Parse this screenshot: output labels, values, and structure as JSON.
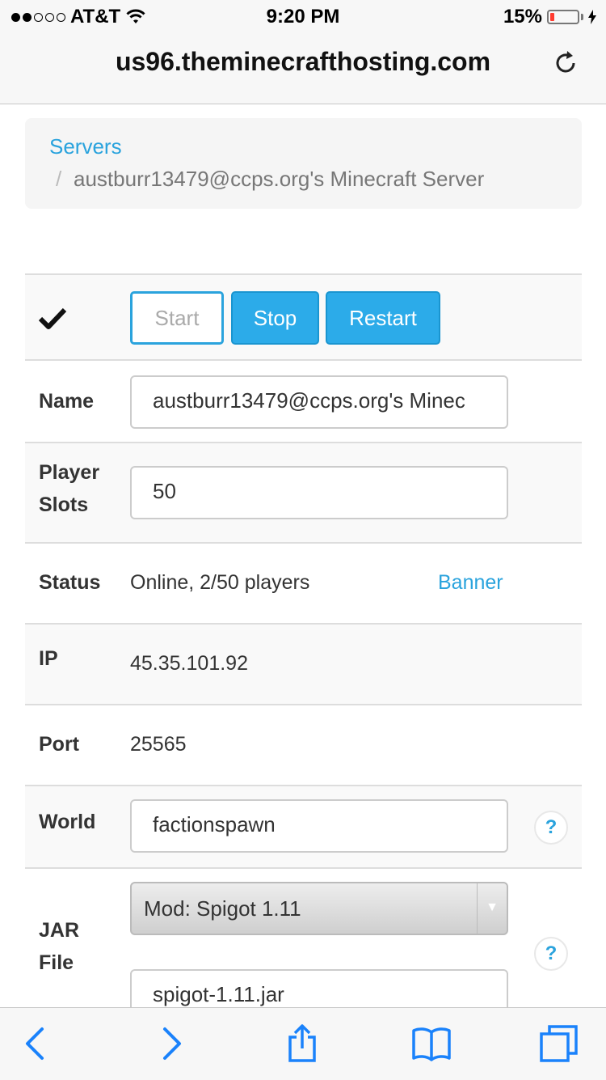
{
  "status_bar": {
    "carrier": "AT&T",
    "signal_bars_filled": 2,
    "signal_bars_total": 5,
    "time": "9:20 PM",
    "battery_percent": "15%",
    "battery_level": 0.15
  },
  "browser": {
    "url": "us96.theminecrafthosting.com"
  },
  "breadcrumb": {
    "root": "Servers",
    "separator": "/",
    "current": "austburr13479@ccps.org's Minecraft Server"
  },
  "controls": {
    "start": "Start",
    "stop": "Stop",
    "restart": "Restart"
  },
  "fields": {
    "name_label": "Name",
    "name_value": "austburr13479@ccps.org's Minec",
    "slots_label_1": "Player",
    "slots_label_2": "Slots",
    "slots_value": "50",
    "status_label": "Status",
    "status_value": "Online, 2/50 players",
    "banner_link": "Banner",
    "ip_label": "IP",
    "ip_value": "45.35.101.92",
    "port_label": "Port",
    "port_value": "25565",
    "world_label": "World",
    "world_value": "factionspawn",
    "jar_label_1": "JAR",
    "jar_label_2": "File",
    "jar_type_selected": "Mod: Spigot 1.11",
    "jar_file_value": "spigot-1.11.jar",
    "help_glyph": "?"
  },
  "colors": {
    "accent": "#2aa3dd",
    "button_blue": "#2cabe9",
    "ios_blue": "#1a82fb"
  }
}
